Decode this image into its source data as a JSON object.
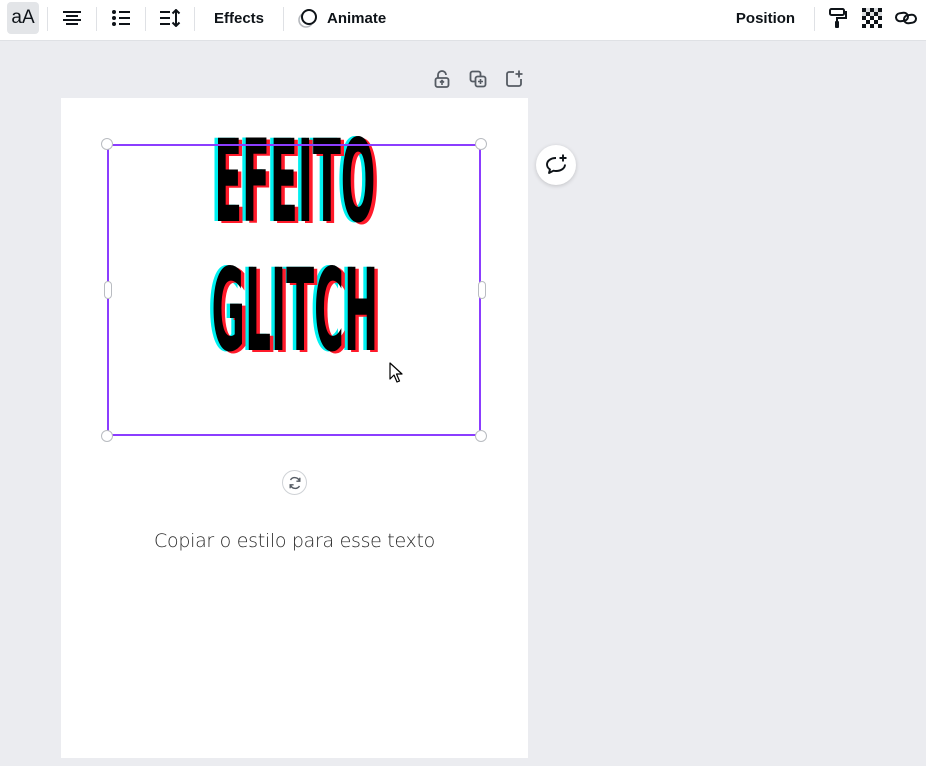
{
  "toolbar": {
    "font_size_label": "aA",
    "effects_label": "Effects",
    "animate_label": "Animate",
    "position_label": "Position"
  },
  "canvas": {
    "headline_line1": "EFEITO",
    "headline_line2": "GLITCH",
    "body_text": "Copiar o estilo para esse texto"
  },
  "colors": {
    "selection": "#8b3dff",
    "glitch_cyan": "#00f0f0",
    "glitch_red": "#ff1a2a",
    "text": "#000000"
  },
  "icons": [
    "text-case-icon",
    "align-center-icon",
    "bullet-list-icon",
    "line-spacing-icon",
    "animate-icon",
    "paint-roller-icon",
    "transparency-icon",
    "link-icon",
    "lock-icon",
    "duplicate-icon",
    "add-page-icon",
    "rotate-icon",
    "add-comment-icon"
  ]
}
